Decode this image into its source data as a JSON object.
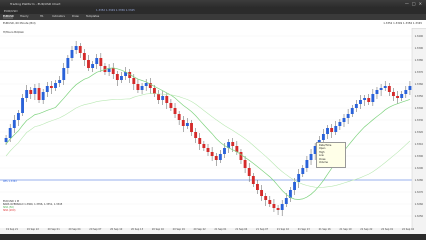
{
  "window": {
    "title": "Trading Platform - EUR/USD Chart",
    "close": "✕",
    "maximize": "□",
    "minimize": "—"
  },
  "menubar": {
    "account": "EUR/USD",
    "quote": "1.3352  1.3349  1.3356  1.3345"
  },
  "toolbar": {
    "symbol": "EURUSD",
    "tf": "Hourly",
    "items": [
      "H1",
      "Indicators",
      "Draw",
      "Templates"
    ]
  },
  "chart": {
    "header_left": "EURUSD, 60 Minute (Bid)",
    "header_right": "1.3352  1.3349  1.3356  1.3345",
    "legend": "H/Hours Bid/Ask",
    "indicator_lines": [
      "EUR/USD 1 M",
      "BARS OVERSOLD 1.3360, 1.3356, 1.3351, 1.3345",
      "SMA (50)",
      "SMA (200)"
    ],
    "hline_label": "RES 1.3363",
    "tooltip": [
      "Date/Time",
      "Open",
      "High",
      "Low",
      "Close",
      "Volume"
    ],
    "price_ticks": [
      "1.3400",
      "1.3390",
      "1.3380",
      "1.3370",
      "1.3360",
      "1.3350",
      "1.3340",
      "1.3330",
      "1.3320",
      "1.3310",
      "1.3300",
      "1.3290",
      "1.3280",
      "1.3270",
      "1.3260",
      "1.3250"
    ],
    "time_ticks": [
      "19 Sep 21",
      "19 Sep 22",
      "20 Sep 01",
      "20 Sep 04",
      "20 Sep 07",
      "20 Sep 10",
      "20 Sep 13",
      "20 Sep 16",
      "20 Sep 19",
      "20 Sep 22",
      "21 Sep 01",
      "21 Sep 04",
      "21 Sep 07",
      "21 Sep 10",
      "21 Sep 13",
      "21 Sep 16",
      "21 Sep 19",
      "21 Sep 22",
      "22 Sep 01",
      "22 Sep 04"
    ]
  },
  "colors": {
    "up": "#2a62d9",
    "down": "#d42b2b",
    "ma_green": "#7fd37f",
    "ma_light": "#b9e8b3"
  }
}
